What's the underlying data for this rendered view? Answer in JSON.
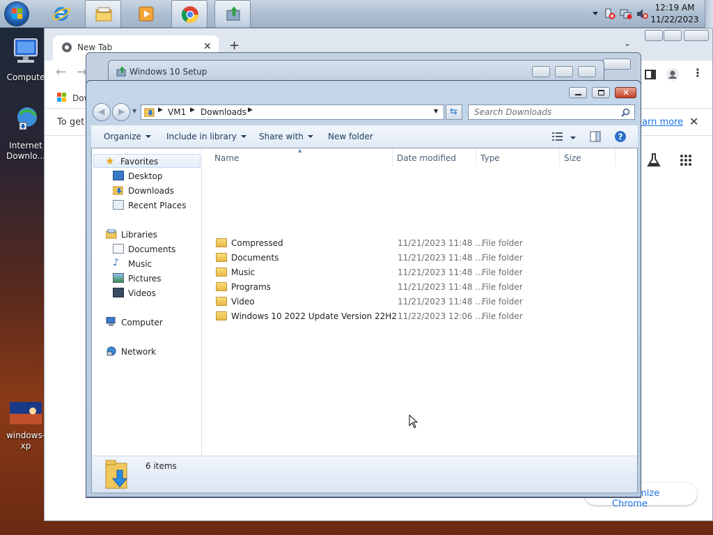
{
  "taskbar": {
    "clock_time": "12:19 AM",
    "clock_date": "11/22/2023"
  },
  "desktop": {
    "icons": [
      {
        "label": "Compute"
      },
      {
        "label": "Internet Downlo..."
      },
      {
        "label": "windows-xp"
      }
    ]
  },
  "chrome": {
    "tab_title": "New Tab",
    "new_tab_symbol": "+",
    "bookmark_label": "Dow",
    "infobar_text": "To get",
    "infobar_link": "earn more",
    "customize_label": "Customize Chrome"
  },
  "setup": {
    "title": "Windows 10 Setup"
  },
  "explorer": {
    "breadcrumb": [
      "VM1",
      "Downloads"
    ],
    "search_placeholder": "Search Downloads",
    "commands": {
      "organize": "Organize",
      "include": "Include in library",
      "share": "Share with",
      "new_folder": "New folder"
    },
    "nav": {
      "favorites": "Favorites",
      "desktop": "Desktop",
      "downloads": "Downloads",
      "recent": "Recent Places",
      "libraries": "Libraries",
      "documents": "Documents",
      "music": "Music",
      "pictures": "Pictures",
      "videos": "Videos",
      "computer": "Computer",
      "network": "Network"
    },
    "columns": {
      "name": "Name",
      "date": "Date modified",
      "type": "Type",
      "size": "Size"
    },
    "files": [
      {
        "name": "Compressed",
        "date": "11/21/2023 11:48 ...",
        "type": "File folder"
      },
      {
        "name": "Documents",
        "date": "11/21/2023 11:48 ...",
        "type": "File folder"
      },
      {
        "name": "Music",
        "date": "11/21/2023 11:48 ...",
        "type": "File folder"
      },
      {
        "name": "Programs",
        "date": "11/21/2023 11:48 ...",
        "type": "File folder"
      },
      {
        "name": "Video",
        "date": "11/21/2023 11:48 ...",
        "type": "File folder"
      },
      {
        "name": "Windows 10  2022 Update Version 22H2",
        "date": "11/22/2023 12:06 ...",
        "type": "File folder"
      }
    ],
    "item_count": "6 items"
  }
}
